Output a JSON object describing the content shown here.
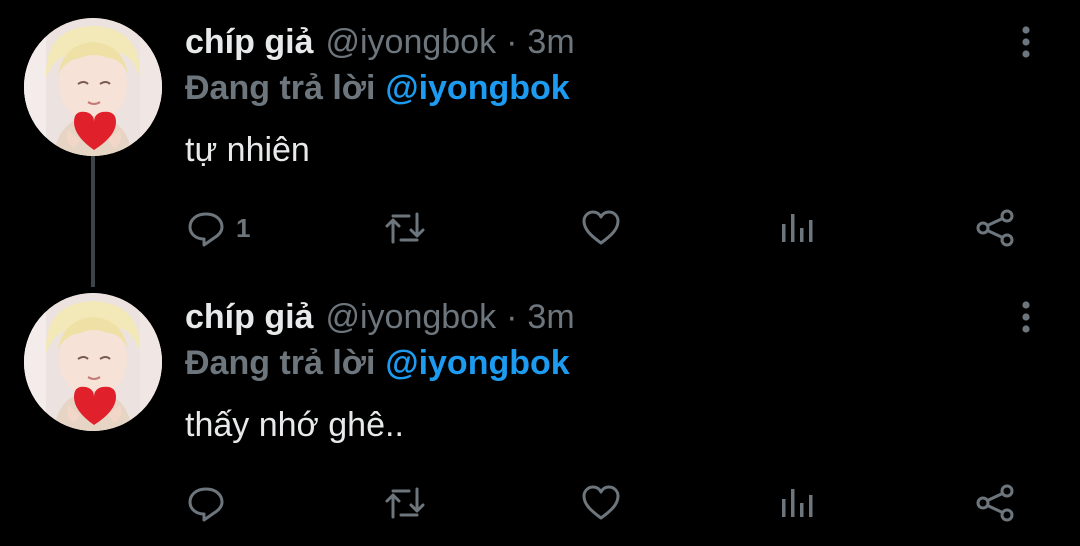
{
  "colors": {
    "background": "#000000",
    "text": "#e7e9ea",
    "muted": "#6e767d",
    "accent": "#1d9bf0",
    "thread_line": "#3d4449"
  },
  "tweets": [
    {
      "display_name": "chíp giả",
      "handle": "@iyongbok",
      "separator": "·",
      "time": "3m",
      "reply_prefix": "Đang trả lời",
      "reply_mention": "@iyongbok",
      "text": "tự nhiên",
      "reply_count": "1",
      "icons": [
        "avatar",
        "more-vertical-icon",
        "reply-icon",
        "retweet-icon",
        "like-icon",
        "stats-icon",
        "share-icon"
      ]
    },
    {
      "display_name": "chíp giả",
      "handle": "@iyongbok",
      "separator": "·",
      "time": "3m",
      "reply_prefix": "Đang trả lời",
      "reply_mention": "@iyongbok",
      "text": "thấy nhớ ghê..",
      "reply_count": "",
      "icons": [
        "avatar",
        "more-vertical-icon",
        "reply-icon",
        "retweet-icon",
        "like-icon",
        "stats-icon",
        "share-icon"
      ]
    }
  ]
}
